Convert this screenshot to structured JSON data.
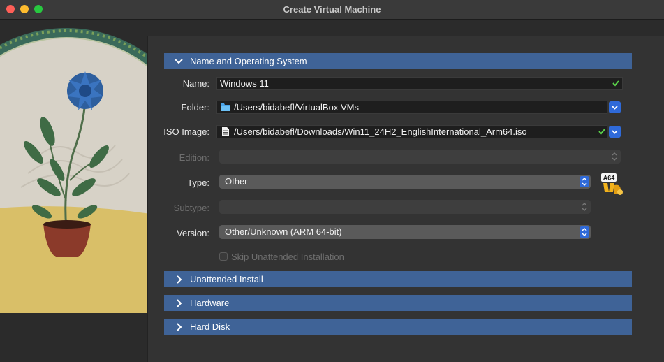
{
  "window": {
    "title": "Create Virtual Machine"
  },
  "sections": {
    "name_os": "Name and Operating System",
    "unattended": "Unattended Install",
    "hardware": "Hardware",
    "hard_disk": "Hard Disk"
  },
  "form": {
    "name_label": "Name:",
    "name_value": "Windows 11",
    "folder_label": "Folder:",
    "folder_value": "/Users/bidabefl/VirtualBox VMs",
    "iso_label": "ISO Image:",
    "iso_value": "/Users/bidabefl/Downloads/Win11_24H2_EnglishInternational_Arm64.iso",
    "edition_label": "Edition:",
    "edition_value": "",
    "type_label": "Type:",
    "type_value": "Other",
    "subtype_label": "Subtype:",
    "subtype_value": "",
    "version_label": "Version:",
    "version_value": "Other/Unknown (ARM 64-bit)",
    "skip_unattended_label": "Skip Unattended Installation",
    "skip_unattended_checked": false
  },
  "os_badge": {
    "text": "A64",
    "icon": "arm64-os-icon"
  },
  "colors": {
    "section_header": "#3f6397",
    "accent": "#2f6ad9",
    "valid_check": "#5ad14a"
  }
}
